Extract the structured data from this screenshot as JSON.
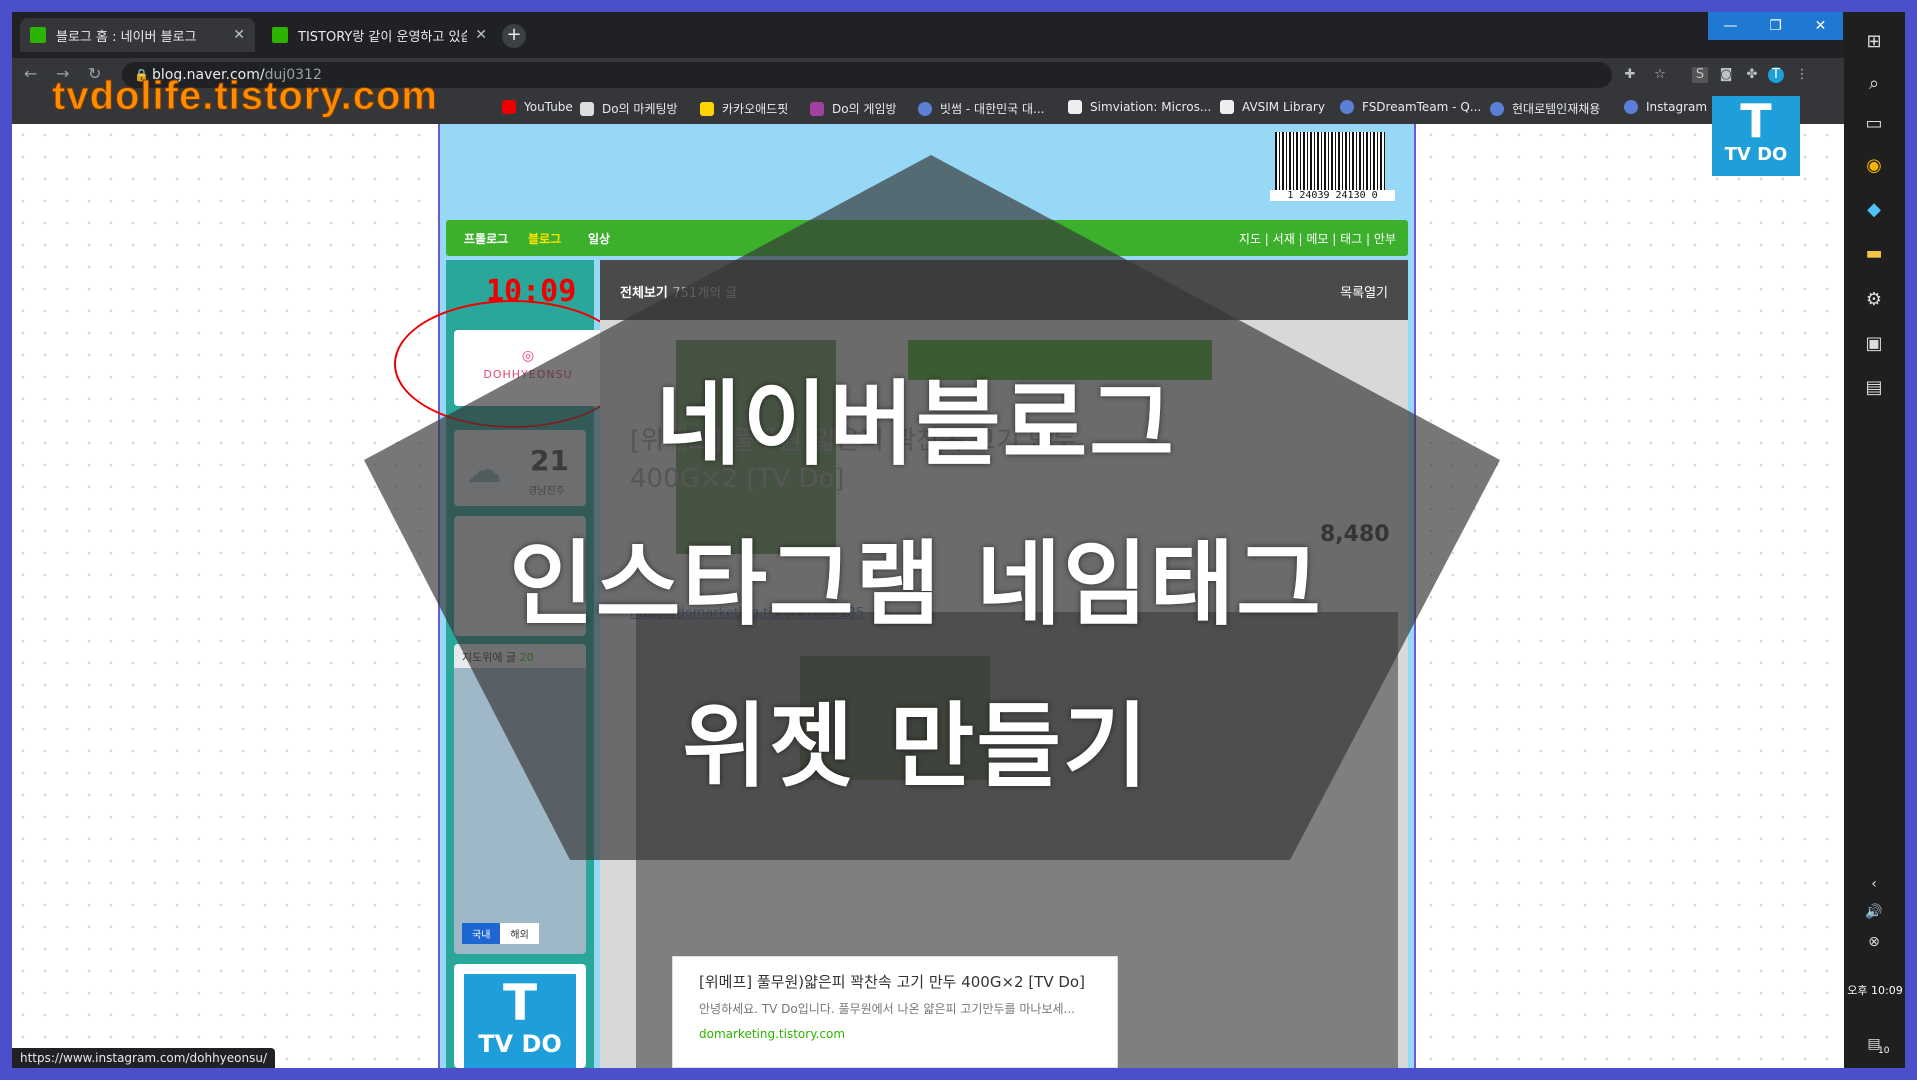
{
  "browser": {
    "tabs": [
      {
        "title": "블로그 홈 : 네이버 블로그",
        "active": true
      },
      {
        "title": "TISTORY랑 같이 운영하고 있습",
        "active": false
      }
    ],
    "url_host": "blog.naver.com/",
    "url_path": "duj0312",
    "bookmarks": [
      "YouTube",
      "Do의 마케팅방",
      "카카오애드핏",
      "Do의 게임방",
      "빗썸 - 대한민국 대...",
      "Simviation: Micros...",
      "AVSIM Library",
      "FSDreamTeam - Q...",
      "현대로템인재채용",
      "Instagram"
    ],
    "status_url": "https://www.instagram.com/dohhyeonsu/"
  },
  "watermark": "tvdolife.tistory.com",
  "blog": {
    "barcode_number": "1 24039 24130 0",
    "menu_left": [
      "프롤로그",
      "블로그",
      "일상"
    ],
    "menu_right": "지도 | 서재 | 메모 | 태그 | 안부",
    "clock": "10:09",
    "instagram_name": "DOHHYEONSU",
    "weather_temp": "21",
    "weather_loc": "경남진주",
    "map_title": "지도위에 글",
    "map_count": "20",
    "map_tabs": [
      "국내",
      "해외"
    ],
    "list_head": "전체보기",
    "list_count": "751개의 글",
    "list_toggle": "목록열기",
    "post_title": "[위메프] 풀무원)얇은피 꽉찬속 고기 만두 400G×2 [TV Do]",
    "post_link": "https://domarketing.tistory.com/185",
    "price": "8,480",
    "card_title": "[위메프] 풀무원)얇은피 꽉찬속 고기 만두 400G×2 [TV Do]",
    "card_desc": "안녕하세요. TV Do입니다. 풀무원에서 나온 얇은피 고기만두를 마나보세...",
    "card_url": "domarketing.tistory.com"
  },
  "overlay": {
    "line1": "네이버블로그",
    "line2": "인스타그램 네임태그",
    "line3": "위젯 만들기"
  },
  "logo": {
    "letter": "T",
    "text": "TV DO"
  },
  "taskbar": {
    "time_label": "오후 10:09",
    "notif_count": "10"
  },
  "colors": {
    "frame": "#4b4fc9",
    "blog_green": "#3cb02c",
    "sidebar_teal": "#2aa79b",
    "watermark": "#ff8c00"
  }
}
